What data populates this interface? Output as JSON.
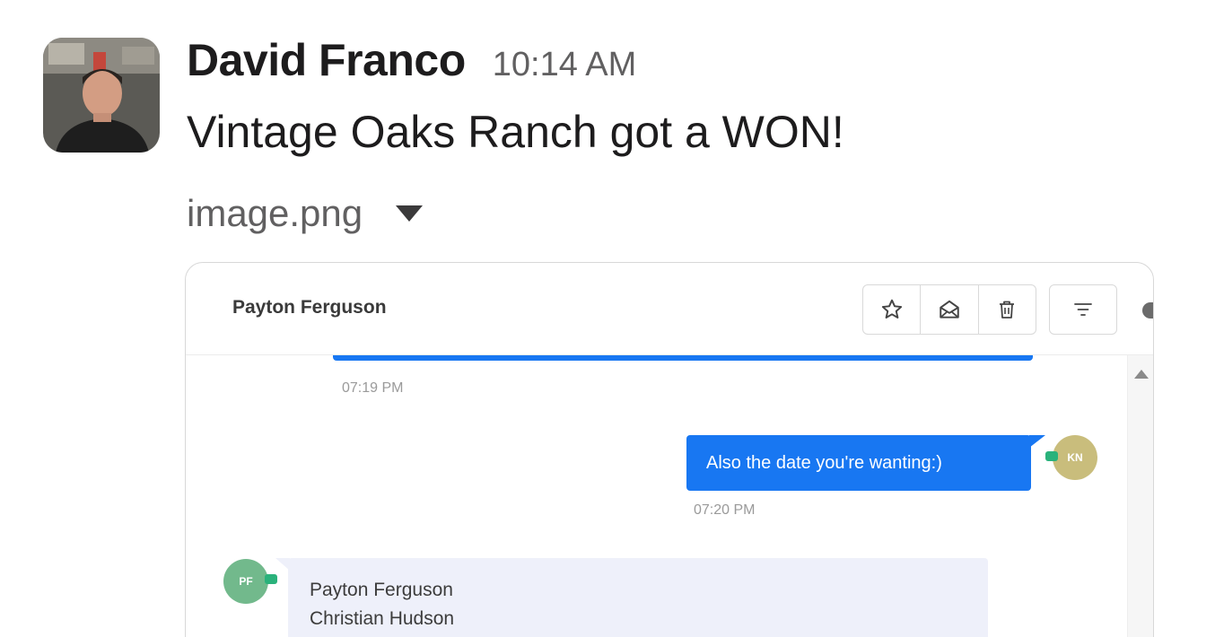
{
  "message": {
    "author": "David Franco",
    "time": "10:14 AM",
    "text": "Vintage Oaks Ranch got a WON!",
    "avatar_icon": "user-photo"
  },
  "attachment": {
    "filename": "image.png",
    "toggle_icon": "caret-down-icon"
  },
  "preview": {
    "contact_name": "Payton Ferguson",
    "toolbar_icons": [
      "star-icon",
      "envelope-open-icon",
      "trash-icon",
      "filter-icon"
    ],
    "messages": [
      {
        "direction": "outgoing",
        "time": "07:19 PM"
      },
      {
        "direction": "outgoing",
        "text": "Also the date you're wanting:)",
        "time": "07:20 PM",
        "avatar_initials": "KN"
      },
      {
        "direction": "incoming",
        "avatar_initials": "PF",
        "lines": [
          "Payton Ferguson",
          "Christian Hudson"
        ]
      }
    ],
    "colors": {
      "outgoing_bubble": "#1877f2",
      "incoming_bubble": "#eef0fa",
      "kn_avatar": "#c9bd7c",
      "pf_avatar": "#72b98c"
    }
  }
}
